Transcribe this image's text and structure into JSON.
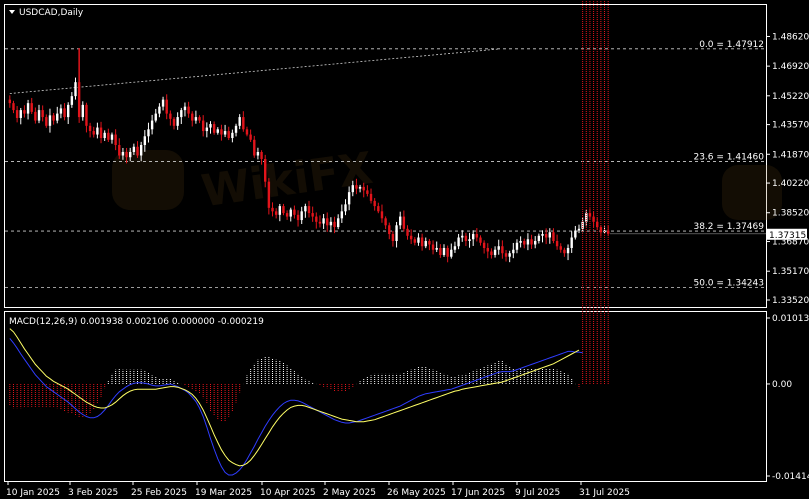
{
  "window": {
    "symbol_label": "USDCAD,Daily",
    "menu_arrow_icon": "triangle-down-icon"
  },
  "colors": {
    "background": "#000000",
    "bull": "#ffffff",
    "bear": "#e3141b",
    "macd_signal": "#ffff66",
    "macd_main": "#2f3dff",
    "fib_line": "#d0d0d0",
    "price_tag_bg": "#ffffff",
    "price_tag_text": "#000000"
  },
  "chart_data": [
    {
      "type": "candlestick",
      "panel": "price",
      "ylim": [
        1.3352,
        1.4899
      ],
      "y_ticks": [
        "1.48620",
        "1.46920",
        "1.45220",
        "1.43570",
        "1.41870",
        "1.40220",
        "1.38520",
        "1.36870",
        "1.35170",
        "1.33520"
      ],
      "x_ticks": [
        "10 Jan 2025",
        "3 Feb 2025",
        "25 Feb 2025",
        "19 Mar 2025",
        "10 Apr 2025",
        "2 May 2025",
        "26 May 2025",
        "17 Jun 2025",
        "9 Jul 2025",
        "31 Jul 2025"
      ],
      "current_price": "1.37315",
      "fibonacci_levels": [
        {
          "label": "0.0 = 1.47912",
          "value": 1.47912
        },
        {
          "label": "23.6 = 1.41460",
          "value": 1.4146
        },
        {
          "label": "38.2 = 1.37469",
          "value": 1.37469
        },
        {
          "label": "50.0 = 1.34243",
          "value": 1.34243
        }
      ],
      "trendline": {
        "from": [
          "2025-01-03",
          1.4535
        ],
        "to": [
          "2025-07-16",
          1.479
        ]
      },
      "closes": [
        1.448,
        1.444,
        1.4395,
        1.444,
        1.442,
        1.448,
        1.443,
        1.438,
        1.444,
        1.44,
        1.435,
        1.441,
        1.438,
        1.442,
        1.445,
        1.44,
        1.447,
        1.452,
        1.46,
        1.44,
        1.447,
        1.435,
        1.432,
        1.43,
        1.434,
        1.428,
        1.431,
        1.427,
        1.43,
        1.424,
        1.418,
        1.42,
        1.417,
        1.42,
        1.423,
        1.418,
        1.424,
        1.429,
        1.433,
        1.438,
        1.442,
        1.446,
        1.45,
        1.442,
        1.439,
        1.435,
        1.44,
        1.444,
        1.446,
        1.442,
        1.438,
        1.44,
        1.438,
        1.432,
        1.434,
        1.436,
        1.431,
        1.433,
        1.43,
        1.432,
        1.428,
        1.431,
        1.435,
        1.44,
        1.433,
        1.43,
        1.427,
        1.418,
        1.42,
        1.416,
        1.403,
        1.388,
        1.386,
        1.384,
        1.389,
        1.385,
        1.383,
        1.387,
        1.384,
        1.381,
        1.386,
        1.389,
        1.385,
        1.383,
        1.38,
        1.379,
        1.382,
        1.378,
        1.38,
        1.377,
        1.382,
        1.386,
        1.39,
        1.397,
        1.401,
        1.399,
        1.4,
        1.398,
        1.396,
        1.392,
        1.389,
        1.386,
        1.382,
        1.378,
        1.373,
        1.369,
        1.378,
        1.383,
        1.376,
        1.372,
        1.37,
        1.368,
        1.371,
        1.366,
        1.369,
        1.367,
        1.364,
        1.365,
        1.361,
        1.365,
        1.36,
        1.364,
        1.366,
        1.371,
        1.372,
        1.369,
        1.37,
        1.373,
        1.371,
        1.368,
        1.365,
        1.363,
        1.361,
        1.364,
        1.366,
        1.362,
        1.36,
        1.362,
        1.364,
        1.368,
        1.369,
        1.367,
        1.37,
        1.367,
        1.369,
        1.372,
        1.373,
        1.371,
        1.374,
        1.369,
        1.366,
        1.364,
        1.362,
        1.365,
        1.371,
        1.375,
        1.376,
        1.38,
        1.385,
        1.383,
        1.38,
        1.377,
        1.374,
        1.375,
        1.3731
      ],
      "macd_hist_range": [
        -0.014146,
        0.010136
      ],
      "macd_y_ticks": [
        "0.010136",
        "0.00",
        "-0.014146"
      ]
    },
    {
      "type": "line",
      "panel": "macd",
      "label": "MACD(12,26,9) 0.001938 0.002106 0.000000 -0.000219",
      "series": [
        {
          "name": "signal",
          "values": [
            0.0085,
            0.008,
            0.0072,
            0.0063,
            0.0054,
            0.0046,
            0.0038,
            0.003,
            0.0024,
            0.0018,
            0.0012,
            0.0008,
            0.0004,
            0.0001,
            -0.0002,
            -0.0005,
            -0.0008,
            -0.0012,
            -0.0016,
            -0.002,
            -0.0024,
            -0.0028,
            -0.0031,
            -0.0034,
            -0.0036,
            -0.0037,
            -0.0037,
            -0.0035,
            -0.0032,
            -0.0028,
            -0.0023,
            -0.0018,
            -0.0014,
            -0.0011,
            -0.0009,
            -0.0008,
            -0.0008,
            -0.0008,
            -0.0008,
            -0.0008,
            -0.0008,
            -0.0007,
            -0.0006,
            -0.0005,
            -0.0004,
            -0.0004,
            -0.0005,
            -0.0007,
            -0.0009,
            -0.0012,
            -0.0016,
            -0.0022,
            -0.003,
            -0.004,
            -0.0052,
            -0.0065,
            -0.0078,
            -0.009,
            -0.0101,
            -0.011,
            -0.0117,
            -0.0121,
            -0.0124,
            -0.0126,
            -0.0125,
            -0.0122,
            -0.0117,
            -0.011,
            -0.0102,
            -0.0093,
            -0.0084,
            -0.0075,
            -0.0066,
            -0.0058,
            -0.0051,
            -0.0045,
            -0.004,
            -0.0036,
            -0.0034,
            -0.0033,
            -0.0033,
            -0.0034,
            -0.0036,
            -0.0038,
            -0.004,
            -0.0042,
            -0.0044,
            -0.0046,
            -0.0048,
            -0.005,
            -0.0052,
            -0.0054,
            -0.0055,
            -0.0056,
            -0.0057,
            -0.0058,
            -0.0058,
            -0.0058,
            -0.0057,
            -0.0056,
            -0.0055,
            -0.0053,
            -0.0051,
            -0.0049,
            -0.0047,
            -0.0045,
            -0.0043,
            -0.0041,
            -0.0039,
            -0.0037,
            -0.0035,
            -0.0033,
            -0.0031,
            -0.0029,
            -0.0027,
            -0.0025,
            -0.0023,
            -0.0021,
            -0.0019,
            -0.0017,
            -0.0015,
            -0.0013,
            -0.0011,
            -0.001,
            -0.0008,
            -0.0007,
            -0.0006,
            -0.0005,
            -0.0004,
            -0.0003,
            -0.0002,
            -0.0001,
            0.0,
            0.0001,
            0.0002,
            0.0003,
            0.0005,
            0.0007,
            0.0009,
            0.0011,
            0.0013,
            0.0015,
            0.0017,
            0.0019,
            0.0021,
            0.0023,
            0.0025,
            0.0027,
            0.0029,
            0.0031,
            0.0034,
            0.0037,
            0.004,
            0.0043,
            0.0046,
            0.0049,
            0.0052
          ]
        },
        {
          "name": "main",
          "values": [
            0.007,
            0.0063,
            0.0055,
            0.0046,
            0.0038,
            0.003,
            0.0022,
            0.0014,
            0.0008,
            0.0002,
            -0.0004,
            -0.0008,
            -0.0012,
            -0.0016,
            -0.002,
            -0.0024,
            -0.0028,
            -0.0033,
            -0.0038,
            -0.0043,
            -0.0047,
            -0.005,
            -0.0052,
            -0.0052,
            -0.005,
            -0.0046,
            -0.004,
            -0.0033,
            -0.0025,
            -0.0018,
            -0.0012,
            -0.0008,
            -0.0004,
            -0.0001,
            0.0001,
            0.0002,
            0.0002,
            0.0001,
            0.0,
            -0.0002,
            -0.0003,
            -0.0003,
            -0.0002,
            -0.0001,
            0.0,
            -0.0002,
            -0.0004,
            -0.0007,
            -0.001,
            -0.0014,
            -0.002,
            -0.0027,
            -0.0037,
            -0.005,
            -0.0066,
            -0.0084,
            -0.01,
            -0.0115,
            -0.0127,
            -0.0136,
            -0.014,
            -0.014,
            -0.0137,
            -0.0132,
            -0.0125,
            -0.0116,
            -0.0106,
            -0.0096,
            -0.0085,
            -0.0075,
            -0.0065,
            -0.0056,
            -0.0048,
            -0.0041,
            -0.0035,
            -0.003,
            -0.0027,
            -0.0025,
            -0.0025,
            -0.0026,
            -0.0028,
            -0.0031,
            -0.0034,
            -0.0037,
            -0.004,
            -0.0043,
            -0.0046,
            -0.0049,
            -0.0052,
            -0.0055,
            -0.0057,
            -0.0059,
            -0.006,
            -0.006,
            -0.0059,
            -0.0058,
            -0.0056,
            -0.0054,
            -0.0052,
            -0.005,
            -0.0048,
            -0.0046,
            -0.0044,
            -0.0042,
            -0.004,
            -0.0038,
            -0.0036,
            -0.0034,
            -0.0031,
            -0.0028,
            -0.0025,
            -0.0022,
            -0.0019,
            -0.0017,
            -0.0015,
            -0.0014,
            -0.0013,
            -0.0012,
            -0.0011,
            -0.001,
            -0.0009,
            -0.0008,
            -0.0006,
            -0.0004,
            -0.0002,
            0.0,
            0.0002,
            0.0004,
            0.0006,
            0.0008,
            0.001,
            0.0012,
            0.0014,
            0.0016,
            0.0018,
            0.0019,
            0.0019,
            0.0019,
            0.002,
            0.0022,
            0.0024,
            0.0026,
            0.0028,
            0.003,
            0.0032,
            0.0034,
            0.0036,
            0.0038,
            0.004,
            0.0042,
            0.0044,
            0.0046,
            0.0048,
            0.005,
            0.005,
            0.0049,
            0.0049,
            0.0048
          ]
        }
      ]
    }
  ]
}
